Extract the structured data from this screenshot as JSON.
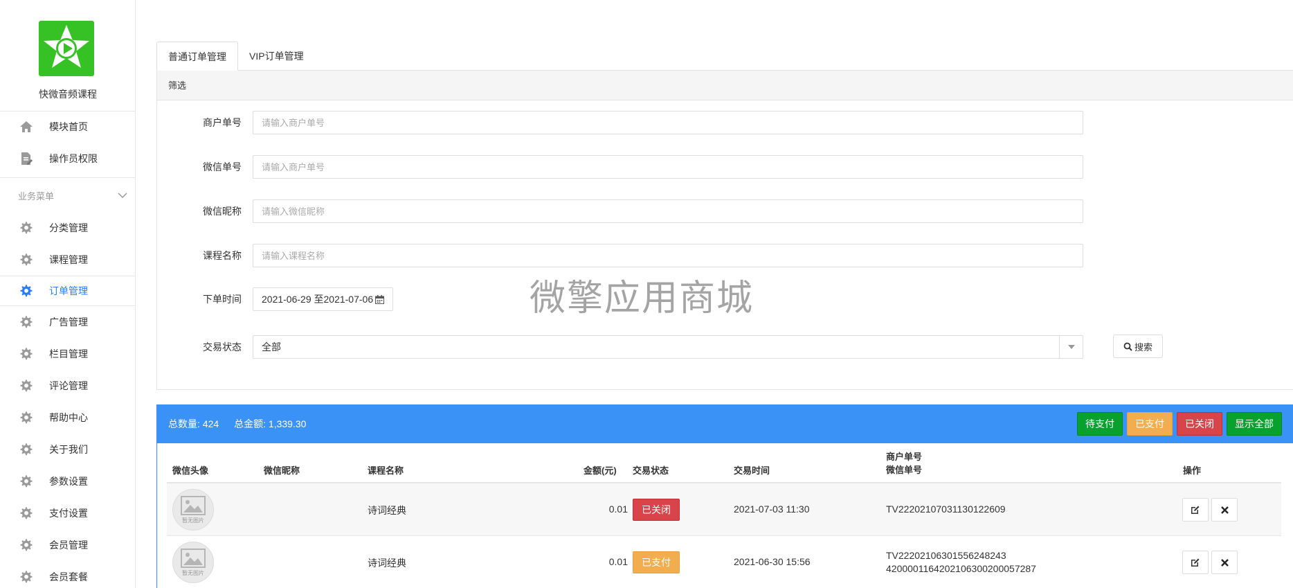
{
  "app": {
    "title": "快微音频课程",
    "logo": "play-star-logo"
  },
  "sidebar": {
    "top_items": [
      {
        "label": "模块首页",
        "icon": "home-icon"
      },
      {
        "label": "操作员权限",
        "icon": "document-edit-icon"
      }
    ],
    "section_title": "业务菜单",
    "items": [
      {
        "label": "分类管理",
        "icon": "gear-icon"
      },
      {
        "label": "课程管理",
        "icon": "gear-icon"
      },
      {
        "label": "订单管理",
        "icon": "gear-icon",
        "active": true
      },
      {
        "label": "广告管理",
        "icon": "gear-icon"
      },
      {
        "label": "栏目管理",
        "icon": "gear-icon"
      },
      {
        "label": "评论管理",
        "icon": "gear-icon"
      },
      {
        "label": "帮助中心",
        "icon": "gear-icon"
      },
      {
        "label": "关于我们",
        "icon": "gear-icon"
      },
      {
        "label": "参数设置",
        "icon": "gear-icon"
      },
      {
        "label": "支付设置",
        "icon": "gear-icon"
      },
      {
        "label": "会员管理",
        "icon": "gear-icon"
      },
      {
        "label": "会员套餐",
        "icon": "gear-icon"
      }
    ]
  },
  "tabs": [
    {
      "label": "普通订单管理",
      "active": true
    },
    {
      "label": "VIP订单管理"
    }
  ],
  "filter": {
    "title": "筛选",
    "merchant_no": {
      "label": "商户单号",
      "placeholder": "请输入商户单号",
      "value": ""
    },
    "wechat_no": {
      "label": "微信单号",
      "placeholder": "请输入商户单号",
      "value": ""
    },
    "nickname": {
      "label": "微信昵称",
      "placeholder": "请输入微信昵称",
      "value": ""
    },
    "course": {
      "label": "课程名称",
      "placeholder": "请输入课程名称",
      "value": ""
    },
    "order_time": {
      "label": "下单时间",
      "value": "2021-06-29 至2021-07-06"
    },
    "status": {
      "label": "交易状态",
      "value": "全部"
    },
    "search_label": "搜索"
  },
  "watermark": "微擎应用商城",
  "summary": {
    "count_label": "总数量:",
    "count": "424",
    "amount_label": "总金额:",
    "amount": "1,339.30",
    "buttons": {
      "pending": "待支付",
      "paid": "已支付",
      "closed": "已关闭",
      "all": "显示全部"
    }
  },
  "table": {
    "headers": {
      "avatar": "微信头像",
      "nickname": "微信昵称",
      "course": "课程名称",
      "amount": "金额(元)",
      "status": "交易状态",
      "time": "交易时间",
      "merchant": "商户单号",
      "wechat": "微信单号",
      "ops": "操作"
    },
    "avatar_caption": "暂无图片",
    "rows": [
      {
        "nickname": "",
        "course": "诗词经典",
        "amount": "0.01",
        "status": "已关闭",
        "status_color": "#d9434a",
        "time": "2021-07-03 11:30",
        "merchant": "TV22202107031130122609",
        "wechat": ""
      },
      {
        "nickname": "",
        "course": "诗词经典",
        "amount": "0.01",
        "status": "已支付",
        "status_color": "#f1ad4e",
        "time": "2021-06-30 15:56",
        "merchant": "TV22202106301556248243",
        "wechat": "4200001164202106300200057287"
      }
    ]
  },
  "colors": {
    "primary": "#3a92f7",
    "green": "#08a12d",
    "orange": "#f1ad4e",
    "red": "#d9434a",
    "logo_green": "#36c125"
  }
}
